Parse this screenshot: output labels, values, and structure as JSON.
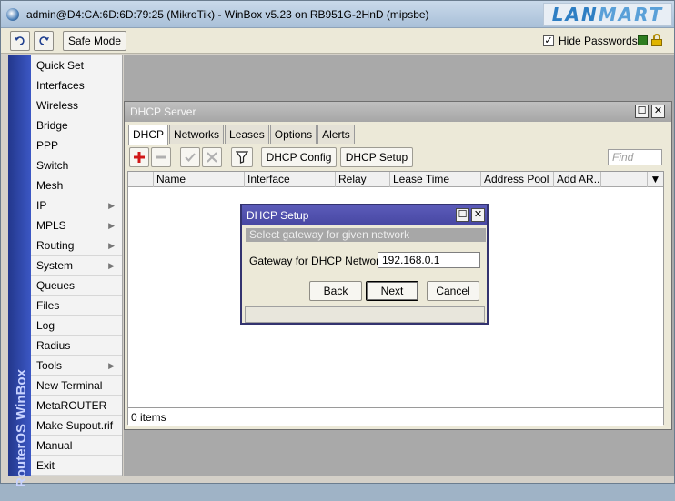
{
  "window": {
    "title": "admin@D4:CA:6D:6D:79:25 (MikroTik) - WinBox v5.23 on RB951G-2HnD (mipsbe)",
    "brand_logo": "LANMART"
  },
  "toolbar": {
    "undo_icon": "undo-icon",
    "redo_icon": "redo-icon",
    "safe_mode_label": "Safe Mode",
    "hide_passwords_label": "Hide Passwords",
    "hide_passwords_checked": true,
    "status_color": "#2e7d1f"
  },
  "sidebar": {
    "vertical_label": "RouterOS WinBox",
    "items": [
      {
        "label": "Quick Set",
        "submenu": false
      },
      {
        "label": "Interfaces",
        "submenu": false
      },
      {
        "label": "Wireless",
        "submenu": false
      },
      {
        "label": "Bridge",
        "submenu": false
      },
      {
        "label": "PPP",
        "submenu": false
      },
      {
        "label": "Switch",
        "submenu": false
      },
      {
        "label": "Mesh",
        "submenu": false
      },
      {
        "label": "IP",
        "submenu": true
      },
      {
        "label": "MPLS",
        "submenu": true
      },
      {
        "label": "Routing",
        "submenu": true
      },
      {
        "label": "System",
        "submenu": true
      },
      {
        "label": "Queues",
        "submenu": false
      },
      {
        "label": "Files",
        "submenu": false
      },
      {
        "label": "Log",
        "submenu": false
      },
      {
        "label": "Radius",
        "submenu": false
      },
      {
        "label": "Tools",
        "submenu": true
      },
      {
        "label": "New Terminal",
        "submenu": false
      },
      {
        "label": "MetaROUTER",
        "submenu": false
      },
      {
        "label": "Make Supout.rif",
        "submenu": false
      },
      {
        "label": "Manual",
        "submenu": false
      },
      {
        "label": "Exit",
        "submenu": false
      }
    ]
  },
  "dhcp_server": {
    "title": "DHCP Server",
    "tabs": [
      "DHCP",
      "Networks",
      "Leases",
      "Options",
      "Alerts"
    ],
    "active_tab": "DHCP",
    "buttons": {
      "dhcp_config": "DHCP Config",
      "dhcp_setup": "DHCP Setup"
    },
    "find_placeholder": "Find",
    "columns": [
      "Name",
      "Interface",
      "Relay",
      "Lease Time",
      "Address Pool",
      "Add AR..."
    ],
    "status": "0 items"
  },
  "dhcp_setup": {
    "title": "DHCP Setup",
    "subtitle": "Select gateway for given network",
    "field_label": "Gateway for DHCP Network:",
    "field_value": "192.168.0.1",
    "back_label": "Back",
    "next_label": "Next",
    "cancel_label": "Cancel"
  }
}
